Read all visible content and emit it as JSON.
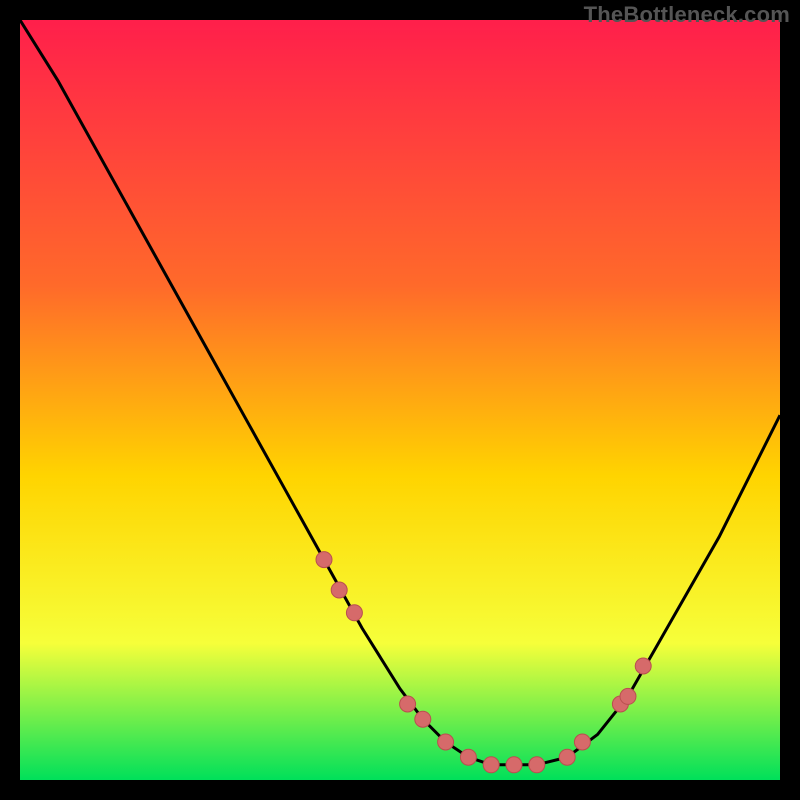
{
  "watermark": "TheBottleneck.com",
  "colors": {
    "frame": "#000000",
    "gradient_top": "#ff1f4b",
    "gradient_mid1": "#ff6a2a",
    "gradient_mid2": "#ffd400",
    "gradient_mid3": "#f6ff3a",
    "gradient_bottom": "#00e05a",
    "curve": "#000000",
    "marker_fill": "#d66a6a",
    "marker_stroke": "#b94f4f"
  },
  "chart_data": {
    "type": "line",
    "title": "",
    "xlabel": "",
    "ylabel": "",
    "xlim": [
      0,
      100
    ],
    "ylim": [
      0,
      100
    ],
    "grid": false,
    "legend": false,
    "series": [
      {
        "name": "bottleneck-curve",
        "x": [
          0,
          5,
          10,
          15,
          20,
          25,
          30,
          35,
          40,
          45,
          50,
          53,
          56,
          59,
          62,
          65,
          68,
          72,
          76,
          80,
          84,
          88,
          92,
          96,
          100
        ],
        "y": [
          100,
          92,
          83,
          74,
          65,
          56,
          47,
          38,
          29,
          20,
          12,
          8,
          5,
          3,
          2,
          2,
          2,
          3,
          6,
          11,
          18,
          25,
          32,
          40,
          48
        ]
      }
    ],
    "markers": {
      "name": "highlighted-points",
      "x": [
        40,
        42,
        44,
        51,
        53,
        56,
        59,
        62,
        65,
        68,
        72,
        74,
        79,
        80,
        82
      ],
      "y": [
        29,
        25,
        22,
        10,
        8,
        5,
        3,
        2,
        2,
        2,
        3,
        5,
        10,
        11,
        15
      ]
    }
  }
}
